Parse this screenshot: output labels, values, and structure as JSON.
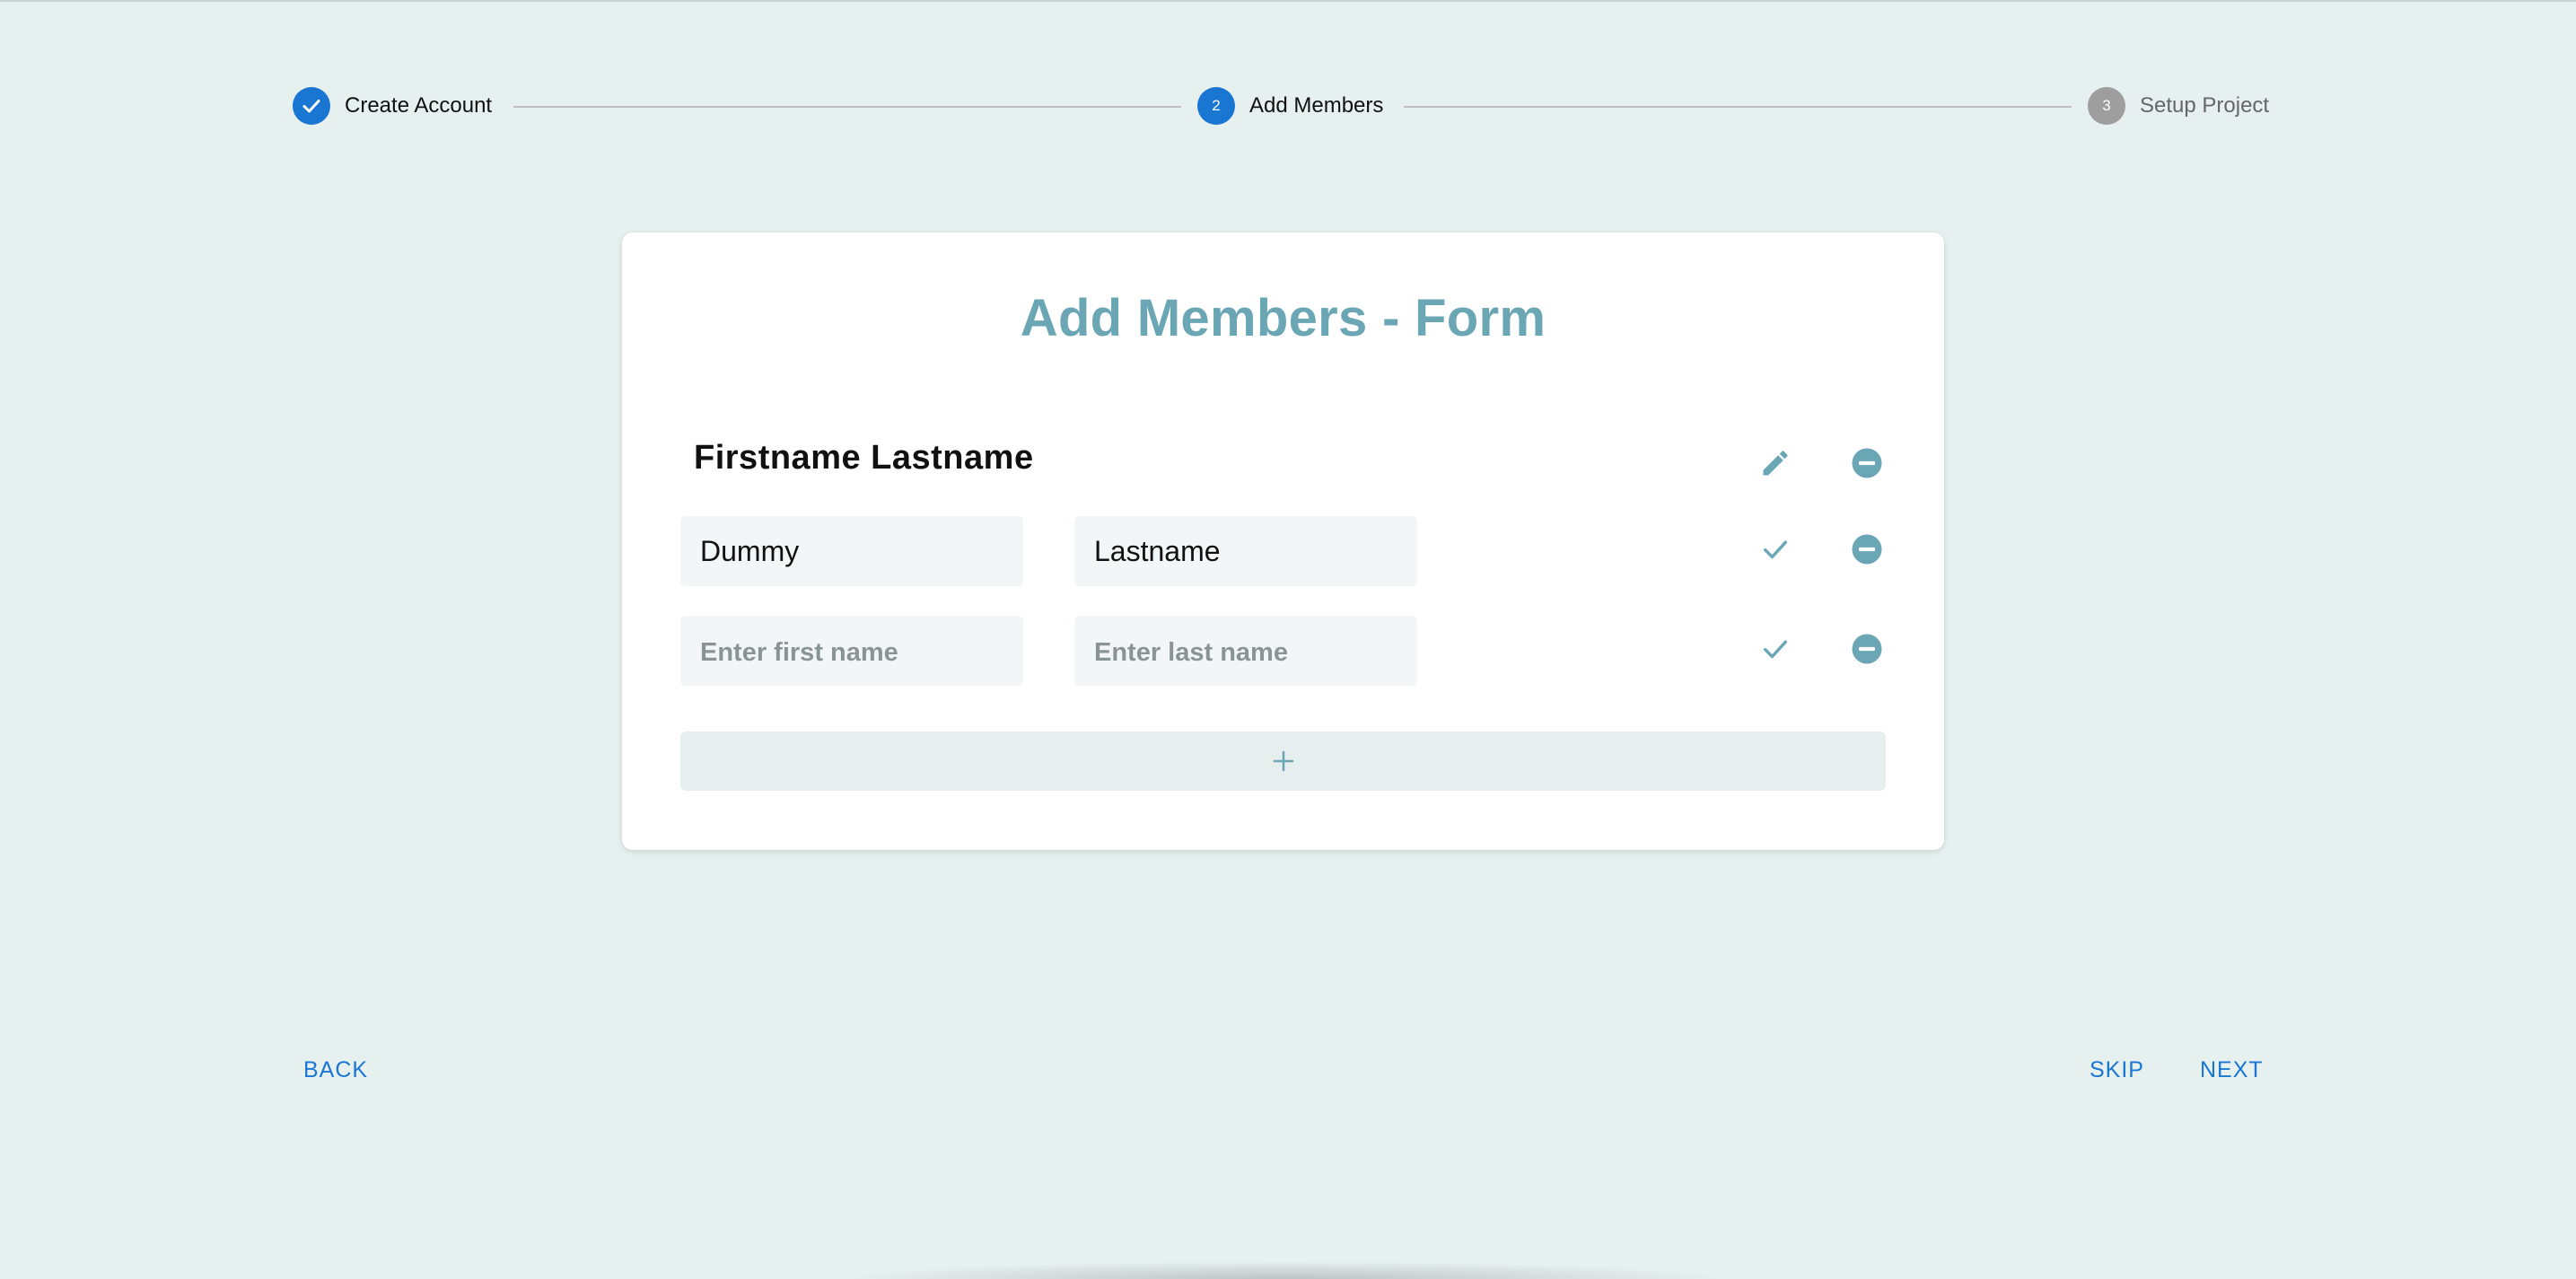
{
  "stepper": {
    "steps": [
      {
        "number": "",
        "label": "Create Account",
        "state": "done"
      },
      {
        "number": "2",
        "label": "Add Members",
        "state": "active"
      },
      {
        "number": "3",
        "label": "Setup Project",
        "state": "pending"
      }
    ]
  },
  "form": {
    "title": "Add Members - Form",
    "members": [
      {
        "display_name": "Firstname Lastname",
        "mode": "view"
      },
      {
        "first_value": "Dummy",
        "last_value": "Lastname",
        "mode": "edit"
      },
      {
        "first_value": "",
        "last_value": "",
        "first_placeholder": "Enter first name",
        "last_placeholder": "Enter last name",
        "mode": "edit"
      }
    ],
    "add_icon": "plus-icon"
  },
  "navigation": {
    "back_label": "BACK",
    "skip_label": "SKIP",
    "next_label": "NEXT"
  },
  "colors": {
    "background": "#e6f0ef",
    "accent": "#6aa6b4",
    "primary": "#1976d2",
    "pending": "#9e9e9e"
  }
}
